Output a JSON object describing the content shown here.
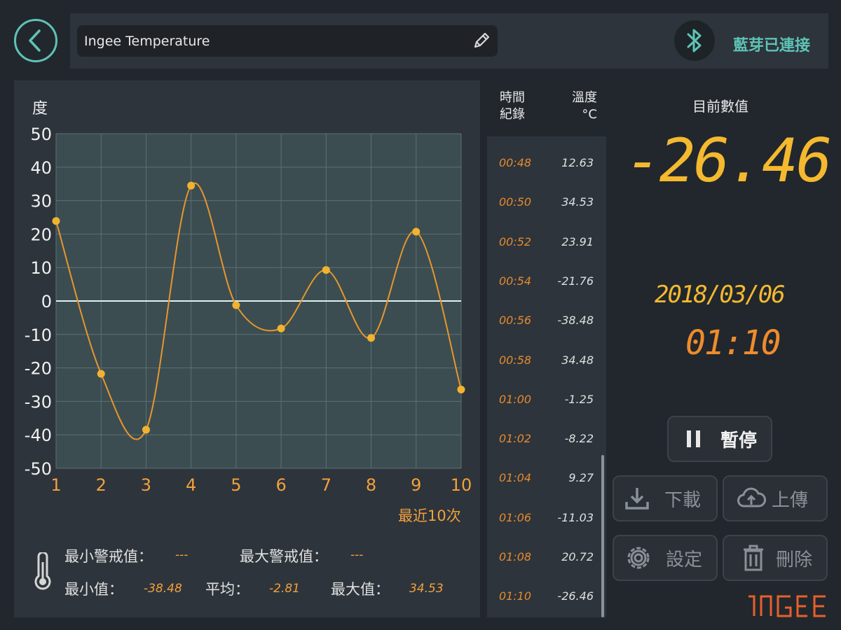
{
  "header": {
    "title": "Ingee Temperature",
    "bluetooth_status": "藍芽已連接",
    "icons": [
      "back-arrow-icon",
      "pencil-edit-icon",
      "bluetooth-icon"
    ]
  },
  "chart_data": {
    "type": "line",
    "ylabel": "度",
    "xlabel": "最近10次",
    "x": [
      1,
      2,
      3,
      4,
      5,
      6,
      7,
      8,
      9,
      10
    ],
    "values": [
      23.91,
      -21.76,
      -38.48,
      34.48,
      -1.25,
      -8.22,
      9.27,
      -11.03,
      20.72,
      -26.46
    ],
    "ylim": [
      -50,
      50
    ],
    "yticks": [
      50,
      40,
      30,
      20,
      10,
      0,
      -10,
      -20,
      -30,
      -40,
      -50
    ],
    "xticks": [
      "1",
      "2",
      "3",
      "4",
      "5",
      "6",
      "7",
      "8",
      "9",
      "10"
    ],
    "grid": true,
    "colors": {
      "line": "#e8962c",
      "plot_bg": "#3b4d51",
      "grid": "#5d7075",
      "zero_line": "#dff3f1",
      "tick_y": "#f0f0f0",
      "tick_x": "#f2a03c"
    }
  },
  "stats": {
    "min_alert_label": "最小警戒值：",
    "min_alert_value": "---",
    "max_alert_label": "最大警戒值：",
    "max_alert_value": "---",
    "min_label": "最小值：",
    "min_value": "-38.48",
    "avg_label": "平均：",
    "avg_value": "-2.81",
    "max_label": "最大值：",
    "max_value": "34.53"
  },
  "log": {
    "header_time": "時間\n紀錄",
    "header_temp": "溫度\n°C",
    "rows": [
      {
        "time": "00:48",
        "temp": "12.63"
      },
      {
        "time": "00:50",
        "temp": "34.53"
      },
      {
        "time": "00:52",
        "temp": "23.91"
      },
      {
        "time": "00:54",
        "temp": "-21.76"
      },
      {
        "time": "00:56",
        "temp": "-38.48"
      },
      {
        "time": "00:58",
        "temp": "34.48"
      },
      {
        "time": "01:00",
        "temp": "-1.25"
      },
      {
        "time": "01:02",
        "temp": "-8.22"
      },
      {
        "time": "01:04",
        "temp": "9.27"
      },
      {
        "time": "01:06",
        "temp": "-11.03"
      },
      {
        "time": "01:08",
        "temp": "20.72"
      },
      {
        "time": "01:10",
        "temp": "-26.46"
      }
    ]
  },
  "current": {
    "label": "目前數值",
    "value": "-26.46",
    "date": "2018/03/06",
    "time": "01:10"
  },
  "buttons": {
    "pause": "暫停",
    "download": "下載",
    "upload": "上傳",
    "settings": "設定",
    "delete": "刪除"
  },
  "brand": {
    "logo_text": "ingee"
  }
}
